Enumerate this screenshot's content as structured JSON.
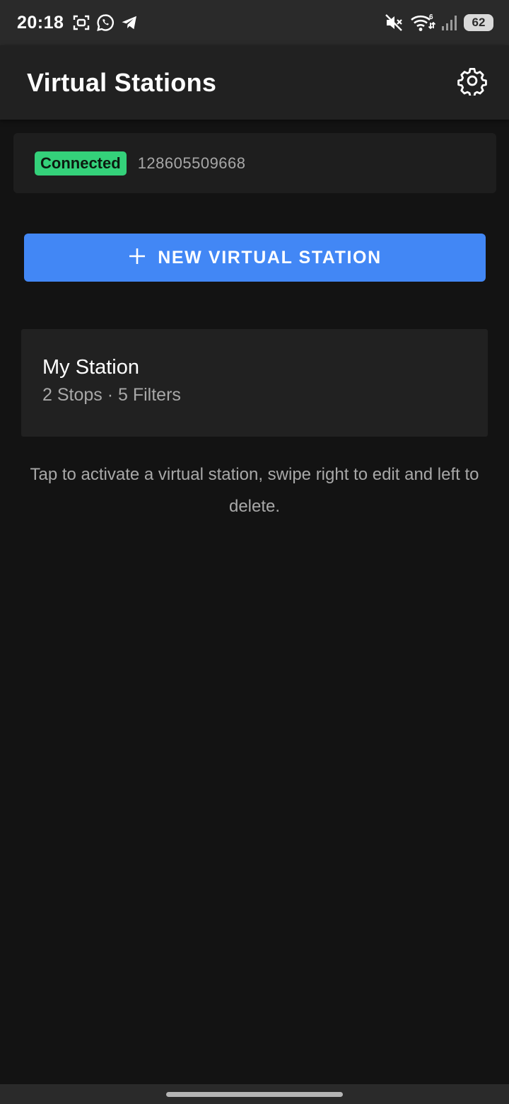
{
  "status_bar": {
    "time": "20:18",
    "left_icons": [
      "screenshot-icon",
      "whatsapp-icon",
      "telegram-icon"
    ],
    "right_icons": [
      "mute-icon",
      "wifi-icon",
      "signal-icon"
    ],
    "wifi_badge": "6",
    "battery": "62"
  },
  "app_bar": {
    "title": "Virtual Stations",
    "settings_icon": "gear-icon"
  },
  "connection": {
    "status": "Connected",
    "id": "128605509668",
    "status_color": "#34d17a"
  },
  "new_station_button": {
    "label": "NEW VIRTUAL STATION",
    "icon": "plus-icon",
    "color": "#4287f5"
  },
  "stations": [
    {
      "name": "My Station",
      "meta": "2 Stops · 5 Filters"
    }
  ],
  "hint": "Tap to activate a virtual station, swipe right to edit and left to delete."
}
